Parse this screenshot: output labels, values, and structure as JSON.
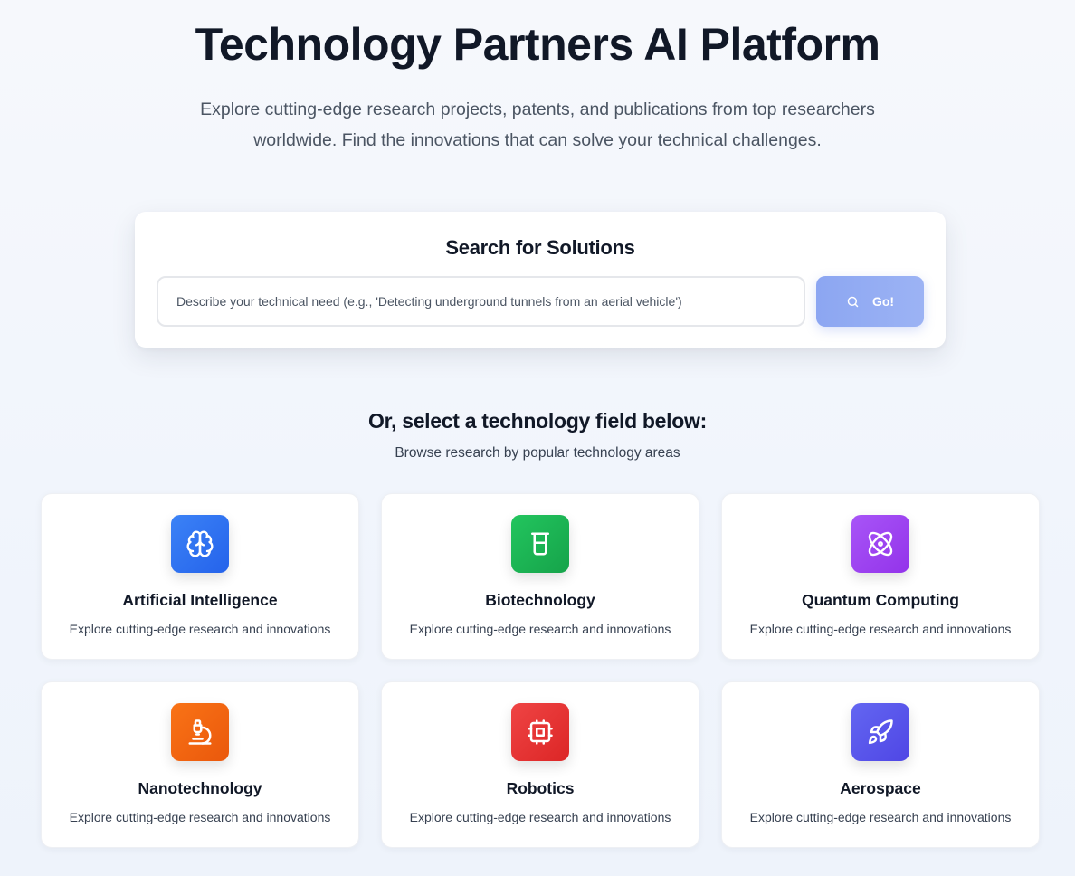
{
  "header": {
    "title": "Technology Partners AI Platform",
    "subtitle_line1": "Explore cutting-edge research projects, patents, and publications from top researchers",
    "subtitle_line2": "worldwide. Find the innovations that can solve your technical challenges."
  },
  "search": {
    "title": "Search for Solutions",
    "value": "",
    "placeholder": "Describe your technical need (e.g., 'Detecting underground tunnels from an aerial vehicle')",
    "button_label": "Go!",
    "button_icon": "search-icon"
  },
  "fields_section": {
    "title": "Or, select a technology field below:",
    "subtitle": "Browse research by popular technology areas"
  },
  "fields": [
    {
      "name": "Artificial Intelligence",
      "description": "Explore cutting-edge research and innovations",
      "icon": "brain-icon",
      "color": "#2563eb"
    },
    {
      "name": "Biotechnology",
      "description": "Explore cutting-edge research and innovations",
      "icon": "beaker-icon",
      "color": "#16a34a"
    },
    {
      "name": "Quantum Computing",
      "description": "Explore cutting-edge research and innovations",
      "icon": "atom-icon",
      "color": "#9333ea"
    },
    {
      "name": "Nanotechnology",
      "description": "Explore cutting-edge research and innovations",
      "icon": "microscope-icon",
      "color": "#ea580c"
    },
    {
      "name": "Robotics",
      "description": "Explore cutting-edge research and innovations",
      "icon": "cpu-icon",
      "color": "#dc2626"
    },
    {
      "name": "Aerospace",
      "description": "Explore cutting-edge research and innovations",
      "icon": "rocket-icon",
      "color": "#4f46e5"
    }
  ]
}
